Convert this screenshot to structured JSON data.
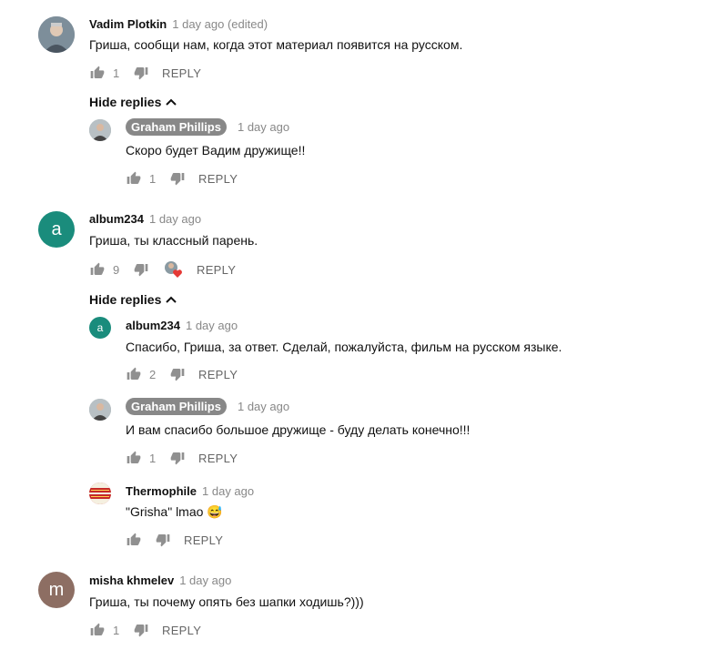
{
  "comments": [
    {
      "author": "Vadim Plotkin",
      "time": "1 day ago (edited)",
      "text": "Гриша, сообщи нам, когда этот материал появится на русском.",
      "likes": "1",
      "reply": "REPLY",
      "hide_replies": "Hide replies",
      "replies": [
        {
          "author": "Graham Phillips",
          "time": "1 day ago",
          "text": "Скоро будет Вадим дружище!!",
          "likes": "1",
          "reply": "REPLY"
        }
      ]
    },
    {
      "author": "album234",
      "avatar_letter": "a",
      "avatar_color": "#1a8c7c",
      "time": "1 day ago",
      "text": "Гриша, ты классный парень.",
      "likes": "9",
      "reply": "REPLY",
      "hide_replies": "Hide replies",
      "replies": [
        {
          "author": "album234",
          "avatar_letter": "a",
          "avatar_color": "#1a8c7c",
          "time": "1 day ago",
          "text": "Спасибо, Гриша, за ответ. Сделай, пожалуйста, фильм на русском языке.",
          "likes": "2",
          "reply": "REPLY"
        },
        {
          "author": "Graham Phillips",
          "time": "1 day ago",
          "text": "И вам спасибо большое дружище - буду делать конечно!!!",
          "likes": "1",
          "reply": "REPLY"
        },
        {
          "author": "Thermophile",
          "time": "1 day ago",
          "text": "\"Grisha\" lmao 😅",
          "likes": "",
          "reply": "REPLY"
        }
      ]
    },
    {
      "author": "misha khmelev",
      "avatar_letter": "m",
      "avatar_color": "#8d6e63",
      "time": "1 day ago",
      "text": "Гриша, ты почему опять без шапки ходишь?)))",
      "likes": "1",
      "reply": "REPLY"
    }
  ],
  "colors": {
    "heart": "#e53935",
    "badge": "#888888"
  }
}
